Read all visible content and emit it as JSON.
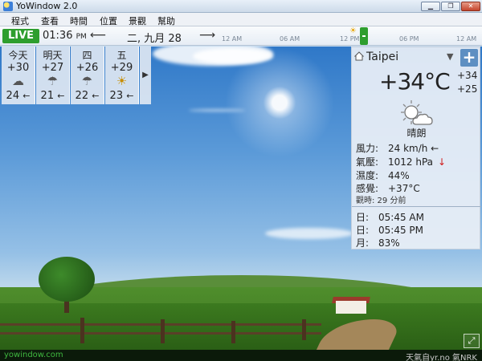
{
  "window": {
    "title": "YoWindow 2.0",
    "controls": {
      "minimize": "▁",
      "maximize": "❐",
      "close": "✕"
    }
  },
  "menu": [
    "程式",
    "查看",
    "時間",
    "位置",
    "景觀",
    "幫助"
  ],
  "timeline": {
    "live_label": "LIVE",
    "time": "01:36",
    "ampm": "PM",
    "back_arrow": "⟵",
    "date": "二, 九月 28",
    "forward_arrow": "⟶",
    "ticks": [
      "12 AM",
      "06 AM",
      "12 PM",
      "06 PM",
      "12 AM"
    ]
  },
  "forecast": {
    "days": [
      {
        "day": "今天",
        "high": "+30",
        "icon": "partly-cloudy-icon",
        "icon_glyph": "☁",
        "low": "24",
        "wind_arrow": "←"
      },
      {
        "day": "明天",
        "high": "+27",
        "icon": "rain-cloud-icon",
        "icon_glyph": "☂",
        "low": "21",
        "wind_arrow": "←"
      },
      {
        "day": "四",
        "high": "+26",
        "icon": "rain-cloud-icon",
        "icon_glyph": "☂",
        "low": "22",
        "wind_arrow": "←"
      },
      {
        "day": "五",
        "high": "+29",
        "icon": "sun-icon",
        "icon_glyph": "☀",
        "low": "23",
        "wind_arrow": "←"
      }
    ],
    "next_label": "▶"
  },
  "current": {
    "city": "Taipei",
    "dropdown_glyph": "▼",
    "add_glyph": "+",
    "temperature": "+34°C",
    "high": "+34",
    "low": "+25",
    "condition": "晴朗",
    "wind_label": "風力:",
    "wind_value": "24 km/h ←",
    "pressure_label": "氣壓:",
    "pressure_value": "1012 hPa",
    "pressure_trend": "↓",
    "humidity_label": "濕度:",
    "humidity_value": "44%",
    "feels_label": "感覺:",
    "feels_value": "+37°C",
    "observed": "觀時: 29 分前",
    "sunrise_label": "日:",
    "sunrise_value": "05:45 AM",
    "sunset_label": "日:",
    "sunset_value": "05:45 PM",
    "moon_label": "月:",
    "moon_value": "83%"
  },
  "status": {
    "site": "yowindow.com",
    "attribution": "天氣自yr.no 氣NRK",
    "fullscreen_glyph": "⤢"
  },
  "colors": {
    "live": "#2e9e2e",
    "add_button": "#5d8fc2",
    "pressure_trend": "#d01b1b",
    "site_link": "#3fb83f"
  }
}
